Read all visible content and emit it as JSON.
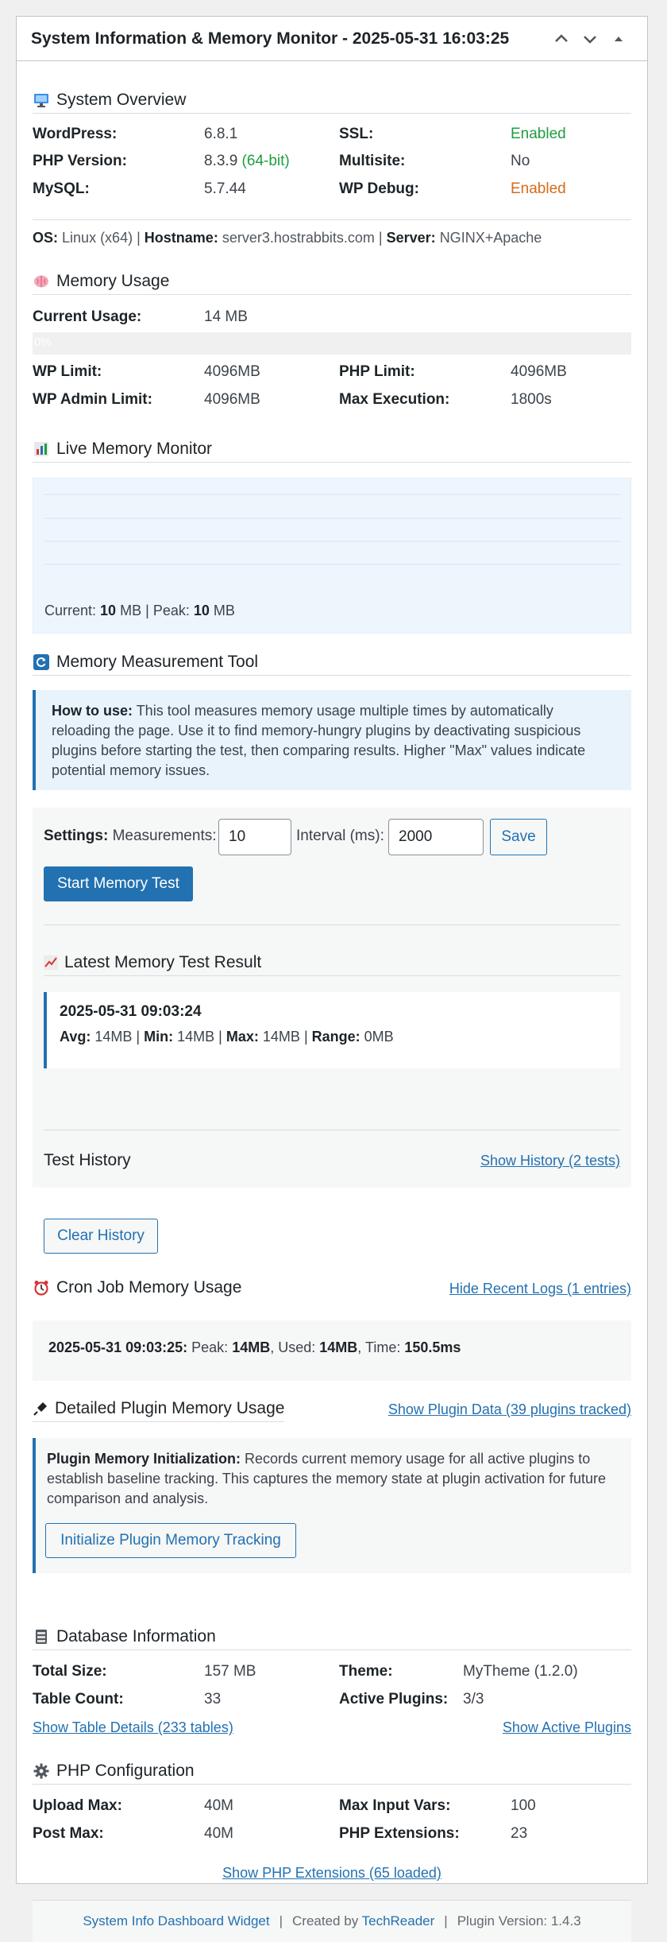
{
  "header": {
    "title": "System Information & Memory Monitor - 2025-05-31 16:03:25"
  },
  "system_overview": {
    "title": "System Overview",
    "wordpress_label": "WordPress:",
    "wordpress_value": "6.8.1",
    "php_label": "PHP Version:",
    "php_value": "8.3.9",
    "php_bits": "(64-bit)",
    "mysql_label": "MySQL:",
    "mysql_value": "5.7.44",
    "ssl_label": "SSL:",
    "ssl_value": "Enabled",
    "multisite_label": "Multisite:",
    "multisite_value": "No",
    "wpdebug_label": "WP Debug:",
    "wpdebug_value": "Enabled",
    "os_label": "OS:",
    "os_value": "Linux (x64)",
    "hostname_label": "Hostname:",
    "hostname_value": "server3.hostrabbits.com",
    "server_label": "Server:",
    "server_value": "NGINX+Apache",
    "sep": "|"
  },
  "memory_usage": {
    "title": "Memory Usage",
    "current_label": "Current Usage:",
    "current_value": "14 MB",
    "bar_text": "0%",
    "bar_fraction": 0,
    "wplimit_label": "WP Limit:",
    "wplimit_value": "4096MB",
    "phplimit_label": "PHP Limit:",
    "phplimit_value": "4096MB",
    "wpadmin_label": "WP Admin Limit:",
    "wpadmin_value": "4096MB",
    "maxexec_label": "Max Execution:",
    "maxexec_value": "1800s"
  },
  "live_monitor": {
    "title": "Live Memory Monitor",
    "current_label": "Current:",
    "current_value": "10",
    "unit": "MB",
    "peak_label": "Peak:",
    "peak_value": "10",
    "sep": "|"
  },
  "measurement_tool": {
    "title": "Memory Measurement Tool",
    "howto_label": "How to use:",
    "howto_text": "This tool measures memory usage multiple times by automatically reloading the page. Use it to find memory-hungry plugins by deactivating suspicious plugins before starting the test, then comparing results. Higher \"Max\" values indicate potential memory issues.",
    "settings_label": "Settings:",
    "measurements_label": "Measurements:",
    "measurements_value": "10",
    "interval_label": "Interval (ms):",
    "interval_value": "2000",
    "save_label": "Save",
    "start_label": "Start Memory Test",
    "latest_title": "Latest Memory Test Result",
    "latest_date": "2025-05-31 09:03:24",
    "avg_label": "Avg:",
    "avg_value": "14MB",
    "min_label": "Min:",
    "min_value": "14MB",
    "max_label": "Max:",
    "max_value": "14MB",
    "range_label": "Range:",
    "range_value": "0MB",
    "sep": "|",
    "history_title": "Test History",
    "show_history": "Show History (2 tests)",
    "clear_history": "Clear History"
  },
  "cron": {
    "title": "Cron Job Memory Usage",
    "toggle": "Hide Recent Logs (1 entries)",
    "entry_date": "2025-05-31 09:03:25:",
    "peak_label": "Peak:",
    "peak_value": "14MB",
    "used_label": "Used:",
    "used_value": "14MB",
    "time_label": "Time:",
    "time_value": "150.5ms",
    "comma": ","
  },
  "plugins": {
    "title": "Detailed Plugin Memory Usage",
    "toggle": "Show Plugin Data (39 plugins tracked)",
    "init_label": "Plugin Memory Initialization:",
    "init_text": "Records current memory usage for all active plugins to establish baseline tracking. This captures the memory state at plugin activation for future comparison and analysis.",
    "init_button": "Initialize Plugin Memory Tracking"
  },
  "database": {
    "title": "Database Information",
    "size_label": "Total Size:",
    "size_value": "157 MB",
    "theme_label": "Theme:",
    "theme_value": "MyTheme (1.2.0)",
    "tables_label": "Table Count:",
    "tables_value": "33",
    "plugins_label": "Active Plugins:",
    "plugins_value": "3/3",
    "show_tables": "Show Table Details (233 tables)",
    "show_plugins": "Show Active Plugins"
  },
  "php_config": {
    "title": "PHP Configuration",
    "upload_label": "Upload Max:",
    "upload_value": "40M",
    "inputvars_label": "Max Input Vars:",
    "inputvars_value": "100",
    "post_label": "Post Max:",
    "post_value": "40M",
    "ext_label": "PHP Extensions:",
    "ext_value": "23",
    "show_ext": "Show PHP Extensions (65 loaded)"
  },
  "footer": {
    "widget_link": "System Info Dashboard Widget",
    "created_by": "Created by",
    "author_link": "TechReader",
    "version": "Plugin Version: 1.4.3",
    "sep": "|"
  },
  "icons": {
    "overview": "monitor-icon",
    "memory": "brain-icon",
    "live": "bar-chart-icon",
    "tool": "refresh-icon",
    "latest": "trend-chart-icon",
    "cron": "alarm-clock-icon",
    "plugins": "plug-icon",
    "database": "database-icon",
    "php": "gear-icon"
  },
  "colors": {
    "accent": "#2271b1",
    "green": "#1f9d3f",
    "orange": "#d86a1a"
  }
}
